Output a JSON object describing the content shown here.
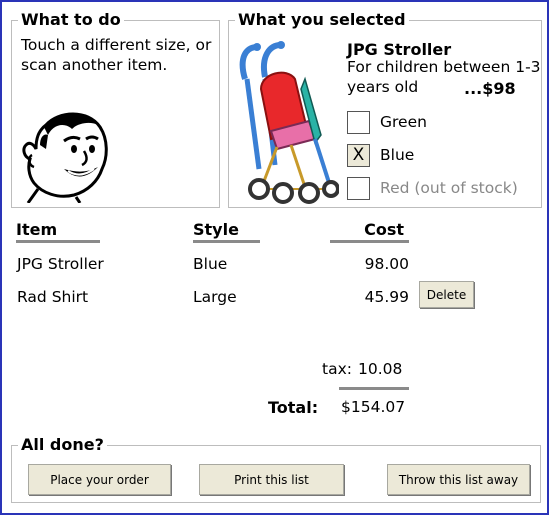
{
  "what_to_do": {
    "title": "What to do",
    "instructions": "Touch a different size, or scan another item."
  },
  "what_you_selected": {
    "title": "What you selected",
    "product_name": "JPG Stroller",
    "description": "For children between 1-3 years old",
    "price": "...$98",
    "options": [
      {
        "label": "Green",
        "mark": "",
        "checked": false,
        "available": true
      },
      {
        "label": "Blue",
        "mark": "X",
        "checked": true,
        "available": true
      },
      {
        "label": "Red (out of stock)",
        "mark": "",
        "checked": false,
        "available": false
      }
    ]
  },
  "table": {
    "headers": {
      "item": "Item",
      "style": "Style",
      "cost": "Cost"
    },
    "rows": [
      {
        "item": "JPG Stroller",
        "style": "Blue",
        "cost": "98.00",
        "action": ""
      },
      {
        "item": "Rad Shirt",
        "style": "Large",
        "cost": "45.99",
        "action": "Delete"
      }
    ]
  },
  "totals": {
    "tax_label": "tax:",
    "tax_value": "10.08",
    "total_label": "Total:",
    "total_value": "$154.07"
  },
  "all_done": {
    "title": "All done?",
    "place_order": "Place your order",
    "print_list": "Print this list",
    "throw_away": "Throw this list away"
  },
  "colors": {
    "window_border": "#2a34b8",
    "button_face": "#ece9d8",
    "stroller_seat": "#e8282b",
    "stroller_frame": "#3a7fd4",
    "stroller_trim": "#2ab3a6"
  },
  "icons": {
    "mascot": "smiling-man-face-icon",
    "product_image": "stroller-icon"
  }
}
